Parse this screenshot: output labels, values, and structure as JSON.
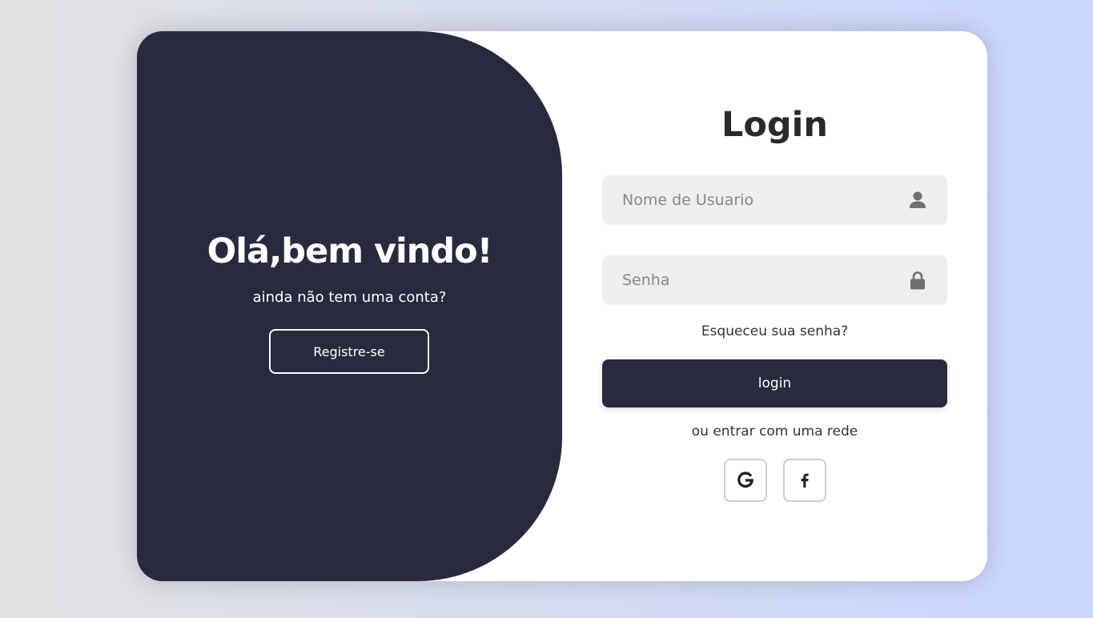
{
  "colors": {
    "panel": "#282a3e",
    "card": "#ffffff",
    "input_bg": "#eeeeee",
    "background_start": "#e2e2e2",
    "background_end": "#c9d6ff"
  },
  "welcome": {
    "title": "Olá,bem vindo!",
    "subtitle": "ainda não tem uma conta?",
    "register_label": "Registre-se"
  },
  "login_form": {
    "title": "Login",
    "username": {
      "placeholder": "Nome de Usuario",
      "value": "",
      "icon": "user-icon"
    },
    "password": {
      "placeholder": "Senha",
      "value": "",
      "icon": "lock-icon"
    },
    "forgot_label": "Esqueceu sua senha?",
    "submit_label": "login",
    "social_text": "ou entrar com uma rede",
    "social": [
      {
        "name": "google",
        "icon": "google-icon"
      },
      {
        "name": "facebook",
        "icon": "facebook-icon"
      }
    ]
  }
}
